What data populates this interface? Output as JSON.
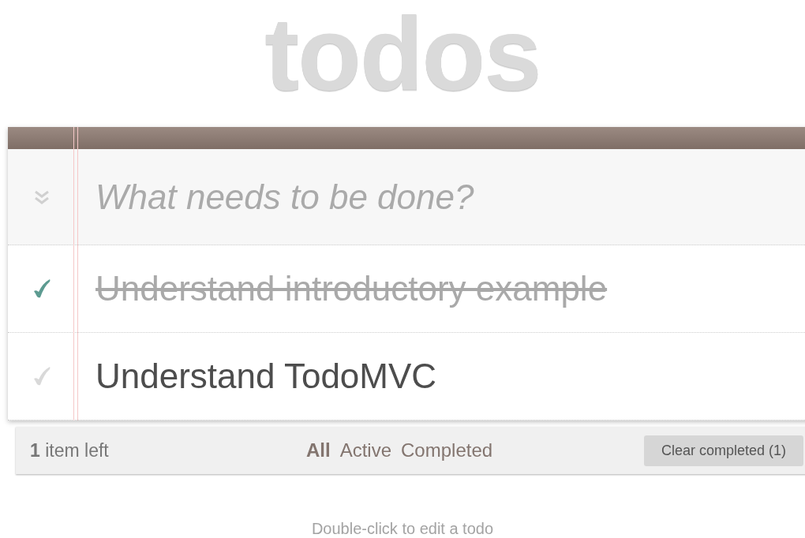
{
  "title": "todos",
  "new_todo": {
    "placeholder": "What needs to be done?"
  },
  "todos": [
    {
      "text": "Understand introductory example",
      "completed": true
    },
    {
      "text": "Understand TodoMVC",
      "completed": false
    }
  ],
  "footer": {
    "count": "**1** item left",
    "filters": [
      {
        "label": "All",
        "selected": true
      },
      {
        "label": "Active",
        "selected": false
      },
      {
        "label": "Completed",
        "selected": false
      }
    ],
    "clear_button": "Clear completed (1)"
  },
  "info": "Double-click to edit a todo"
}
